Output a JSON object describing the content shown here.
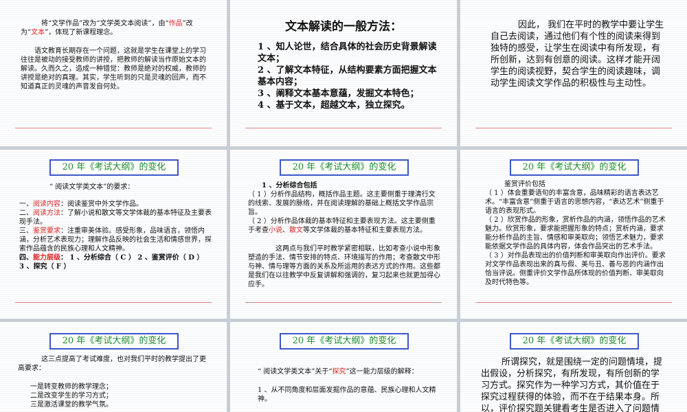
{
  "heading": "20 年《考试大纲》的变化",
  "s1": {
    "p1a": "将“文学作品”改为“文学类文本阅读”，由“",
    "p1b": "作品",
    "p1c": "”改为“",
    "p1d": "文本",
    "p1e": "”，体现了新课程理念。",
    "p2": "语文教育长期存在一个问题，这就是学生在课堂上的学习往往是被动的接受教师的讲授，把教师的解读当作原始文本的解读。久而久之，造成一种错觉：教师是绝对的权威，教师的讲授是绝对的真理。其实，学生听到的只是灵魂的回声，而不知道真正的灵魂的声音发自何处。"
  },
  "s2": {
    "title": "文本解读的一般方法：",
    "items": [
      "1 、知人论世，结合具体的社会历史背景解读文本；",
      "2 、了解文本特征，从结构要素方面把握文本基本内容；",
      "3 、阐释文本基本意蕴，发掘文本特色；",
      "4 、基于文本，超越文本，独立探究。"
    ]
  },
  "s3": {
    "text": "因此， 我们在平时的教学中要让学生自己去阅读，通过他们有个性的阅读来得到独特的感受，让学生在阅读中有所发现，有所创新，达到有创意的阅读。这样才能开阔学生的阅读视野，契合学生的阅读趣味，调动学生阅读文学作品的积极性与主动性。"
  },
  "s4": {
    "intro": "“ 阅读文学类文本”的要求：",
    "l1a": "一、",
    "l1b": "阅读内容",
    "l1c": "：阅读鉴赏中外文学作品。",
    "l2a": "二、",
    "l2b": "阅读方法",
    "l2c": "：了解小说和散文等文学体裁的基本特征及主要表现手法。",
    "l3a": "三、",
    "l3b": "鉴赏要求",
    "l3c": "：注重审美体验。感受形象，品味语言，领悟内涵，分析艺术表现力；理解作品反映的社会生活和情感世界，探索作品蕴含的民族心理和人文精神。",
    "l4a": "四、",
    "l4b": "能力层级",
    "l4c": "： 1 、分析综合（ C ） 2 、鉴赏评价（ D ）",
    "l5": "3 、探究（ F ）"
  },
  "s5": {
    "p1": "1 、分析综合包括",
    "p2": "（ 1 ）分析作品结构，概括作品主题。这主要侧重于理清行文的线索、发展的脉络，并在阅读理解的基础上概括文学作品宗旨。",
    "p3a": "（ 2 ）分析作品体裁的基本特征和主要表现方法。这主要侧重于考查",
    "p3b": "小说",
    "p3c": "、",
    "p3d": "散文",
    "p3e": "等文学体裁的基本特征和主要表现方法。",
    "p4": "这两点与我们平时教学紧密相联，比如考查小说中形象塑造的手法、情节安排的特点、环境描写的作用；考查散文中形与神、情与理等方面的关系及所运用的表达方式的作用。这些都是我们在以往教学中反复讲解和强调的，复习起来也就更加得心应手。"
  },
  "s6": {
    "p1": "鉴赏评价包括",
    "p2": "（ 1 ）体会重要语句的丰富含意，品味精彩的语言表达艺术。“丰富含意”侧重于语言的思想内容，“表达艺术”侧重于语言的表现形式。",
    "p3": "（ 2 ）欣赏作品的形象，赏析作品的内涵，领悟作品的艺术魅力。欣赏形象，要求能把握形象的特点；赏析内涵，要求能分析作品的主旨、情感和审美取向；领悟艺术魅力，要求能依据文学作品的具体内容，体会作品突出的艺术手法。",
    "p4": "（ 3 ）对作品表现出的价值判断和审美取向作出评价。要求对文学作品表现出来的真与假、美与丑、善与恶的内涵作出恰当评说。侧重评价文学作品所体现的价值判断、审美取向及时代特色等。"
  },
  "s7": {
    "p1": "这三点提高了考试难度，也对我们平时的教学提出了更高要求：",
    "items": [
      "一是转变教师的教学理念；",
      "二是改变学生的学习方式；",
      "三是激活课堂的教学气氛。"
    ]
  },
  "s8": {
    "p1a": "“ 阅读文学类文本”关于“",
    "p1b": "探究",
    "p1c": "”这一能力层级的解释：",
    "p2": "1 、从不同角度和层面发掘作品的意蕴、民族心理和人文精神。"
  },
  "s9": {
    "text": "所谓探究，就是围绕一定的问题情境，提出假设，分析探究，有所发现，有所创新的学习方式。探究作为一种学习方式，其价值在于探究过程获得的体验，而不在于结果本身。所以，评价探究题关键看考生是否进入了问题情"
  }
}
